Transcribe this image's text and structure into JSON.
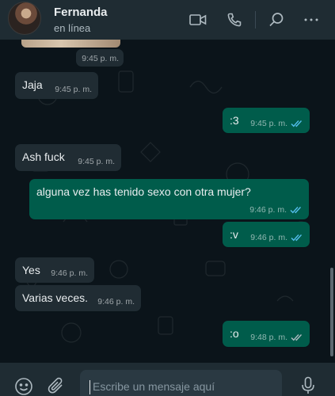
{
  "header": {
    "contact_name": "Fernanda",
    "contact_status": "en línea",
    "icons": [
      "video-call-icon",
      "voice-call-icon",
      "search-icon",
      "menu-icon"
    ]
  },
  "messages": [
    {
      "id": "m1",
      "direction": "in",
      "text": "",
      "time": "9:45 p. m.",
      "kind": "image-caption"
    },
    {
      "id": "m2",
      "direction": "in",
      "text": "Jaja",
      "time": "9:45 p. m."
    },
    {
      "id": "m3",
      "direction": "out",
      "text": ":3",
      "time": "9:45 p. m.",
      "read": true
    },
    {
      "id": "m4",
      "direction": "in",
      "text": "Ash fuck",
      "time": "9:45 p. m."
    },
    {
      "id": "m5",
      "direction": "out",
      "text": "alguna vez has tenido sexo con otra mujer?",
      "time": "9:46 p. m.",
      "read": true
    },
    {
      "id": "m6",
      "direction": "out",
      "text": ":v",
      "time": "9:46 p. m.",
      "read": true
    },
    {
      "id": "m7",
      "direction": "in",
      "text": "Yes",
      "time": "9:46 p. m."
    },
    {
      "id": "m8",
      "direction": "in",
      "text": "Varias veces.",
      "time": "9:46 p. m."
    },
    {
      "id": "m9",
      "direction": "out",
      "text": ":o",
      "time": "9:48 p. m.",
      "read": true
    }
  ],
  "composer": {
    "placeholder": "Escribe un mensaje aquí"
  },
  "colors": {
    "header_bg": "#1f2c33",
    "chat_bg": "#0b141a",
    "incoming_bubble": "#202c33",
    "outgoing_bubble": "#005c4b",
    "read_ticks": "#53bdeb",
    "icon": "#aebac1"
  }
}
